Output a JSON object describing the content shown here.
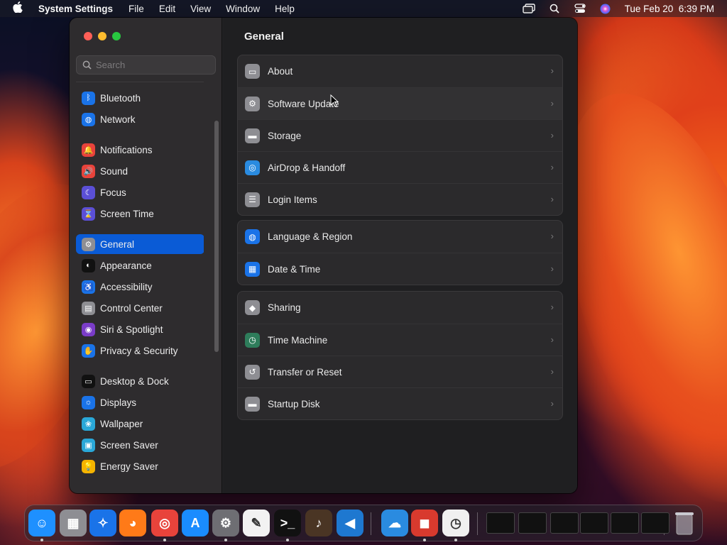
{
  "menubar": {
    "app_name": "System Settings",
    "menus": [
      "File",
      "Edit",
      "View",
      "Window",
      "Help"
    ],
    "clock": "Tue Feb 20  6:39 PM"
  },
  "window": {
    "search_placeholder": "Search",
    "sidebar": {
      "items": [
        {
          "label": "Bluetooth",
          "icon": "bluetooth-icon",
          "color": "#1a73e8",
          "glyph": "ᛒ"
        },
        {
          "label": "Network",
          "icon": "globe-icon",
          "color": "#1a73e8",
          "glyph": "◍"
        },
        {
          "label": "Notifications",
          "icon": "bell-icon",
          "color": "#e8433b",
          "glyph": "🔔"
        },
        {
          "label": "Sound",
          "icon": "speaker-icon",
          "color": "#e8433b",
          "glyph": "🔊"
        },
        {
          "label": "Focus",
          "icon": "moon-icon",
          "color": "#5b4fd6",
          "glyph": "☾"
        },
        {
          "label": "Screen Time",
          "icon": "hourglass-icon",
          "color": "#5b4fd6",
          "glyph": "⌛"
        },
        {
          "label": "General",
          "icon": "gear-icon",
          "color": "#8e8e93",
          "glyph": "⚙",
          "selected": true
        },
        {
          "label": "Appearance",
          "icon": "appearance-icon",
          "color": "#111111",
          "glyph": "◐"
        },
        {
          "label": "Accessibility",
          "icon": "accessibility-icon",
          "color": "#1a73e8",
          "glyph": "♿"
        },
        {
          "label": "Control Center",
          "icon": "toggles-icon",
          "color": "#8e8e93",
          "glyph": "▤"
        },
        {
          "label": "Siri & Spotlight",
          "icon": "siri-icon",
          "color": "#7a3cc8",
          "glyph": "◉"
        },
        {
          "label": "Privacy & Security",
          "icon": "hand-icon",
          "color": "#1a73e8",
          "glyph": "✋"
        },
        {
          "label": "Desktop & Dock",
          "icon": "dock-icon",
          "color": "#111111",
          "glyph": "▭"
        },
        {
          "label": "Displays",
          "icon": "sun-icon",
          "color": "#1a73e8",
          "glyph": "☼"
        },
        {
          "label": "Wallpaper",
          "icon": "flower-icon",
          "color": "#2aa8d8",
          "glyph": "❀"
        },
        {
          "label": "Screen Saver",
          "icon": "screensaver-icon",
          "color": "#2aa8d8",
          "glyph": "▣"
        },
        {
          "label": "Energy Saver",
          "icon": "bulb-icon",
          "color": "#f5b400",
          "glyph": "💡"
        }
      ]
    },
    "main": {
      "title": "General",
      "groups": [
        [
          {
            "label": "About",
            "icon": "computer-icon",
            "color": "#8e8e93",
            "glyph": "▭"
          },
          {
            "label": "Software Update",
            "icon": "gear-badge-icon",
            "color": "#8e8e93",
            "glyph": "⚙"
          },
          {
            "label": "Storage",
            "icon": "drive-icon",
            "color": "#8e8e93",
            "glyph": "▬"
          },
          {
            "label": "AirDrop & Handoff",
            "icon": "airdrop-icon",
            "color": "#2a8be0",
            "glyph": "◎"
          },
          {
            "label": "Login Items",
            "icon": "list-icon",
            "color": "#8e8e93",
            "glyph": "☰"
          }
        ],
        [
          {
            "label": "Language & Region",
            "icon": "globe-icon",
            "color": "#1a73e8",
            "glyph": "◍"
          },
          {
            "label": "Date & Time",
            "icon": "calendar-icon",
            "color": "#1a73e8",
            "glyph": "▦"
          }
        ],
        [
          {
            "label": "Sharing",
            "icon": "sharing-icon",
            "color": "#8e8e93",
            "glyph": "◆"
          },
          {
            "label": "Time Machine",
            "icon": "clock-icon",
            "color": "#2e7d5b",
            "glyph": "◷"
          },
          {
            "label": "Transfer or Reset",
            "icon": "reset-icon",
            "color": "#8e8e93",
            "glyph": "↺"
          },
          {
            "label": "Startup Disk",
            "icon": "disk-icon",
            "color": "#8e8e93",
            "glyph": "▬"
          }
        ]
      ]
    }
  },
  "dock": {
    "apps": [
      {
        "name": "finder-icon",
        "color": "#1e90ff",
        "glyph": "☺"
      },
      {
        "name": "launchpad-icon",
        "color": "#8e8e93",
        "glyph": "▦"
      },
      {
        "name": "safari-icon",
        "color": "#1a73e8",
        "glyph": "✧"
      },
      {
        "name": "firefox-icon",
        "color": "#ff7a18",
        "glyph": "◕"
      },
      {
        "name": "chrome-icon",
        "color": "#e8433b",
        "glyph": "◎"
      },
      {
        "name": "app-store-icon",
        "color": "#1a8cff",
        "glyph": "A"
      },
      {
        "name": "system-settings-icon",
        "color": "#6e6e73",
        "glyph": "⚙"
      },
      {
        "name": "textedit-icon",
        "color": "#f2f2f2",
        "glyph": "✎"
      },
      {
        "name": "terminal-icon",
        "color": "#111111",
        "glyph": ">_"
      },
      {
        "name": "guitar-icon",
        "color": "#4a3524",
        "glyph": "♪"
      },
      {
        "name": "vscode-icon",
        "color": "#1e78d0",
        "glyph": "◀"
      },
      {
        "name": "weather-icon",
        "color": "#2a8be0",
        "glyph": "☁"
      },
      {
        "name": "photo-booth-icon",
        "color": "#d83a2e",
        "glyph": "◼"
      },
      {
        "name": "clock-app-icon",
        "color": "#f0f0f0",
        "glyph": "◷"
      }
    ]
  }
}
